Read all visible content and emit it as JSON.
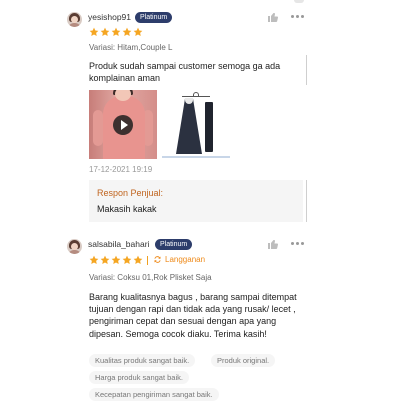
{
  "reviews": [
    {
      "username": "yesishop91",
      "badge": "Platinum",
      "rating": 5,
      "variation": "Variasi: Hitam,Couple L",
      "comment": "Produk sudah sampai customer semoga ga ada komplainan aman",
      "media": [
        {
          "type": "video",
          "icon": "play-icon"
        },
        {
          "type": "photo"
        }
      ],
      "timestamp": "17-12-2021 19:19",
      "seller_response": {
        "label": "Respon Penjual:",
        "text": "Makasih kakak"
      }
    },
    {
      "username": "salsabila_bahari",
      "badge": "Platinum",
      "rating": 5,
      "subscriber_label": "Langganan",
      "variation": "Variasi: Coksu 01,Rok Plisket Saja",
      "comment": "Barang kualitasnya bagus , barang sampai ditempat tujuan dengan rapi dan tidak ada yang rusak/ lecet , pengiriman cepat dan sesuai dengan apa yang dipesan. Semoga cocok diaku. Terima kasih!",
      "tags": [
        "Kualitas produk sangat baik.",
        "Produk original.",
        "Harga produk sangat baik.",
        "Kecepatan pengiriman sangat baik."
      ]
    }
  ],
  "colors": {
    "star": "#f5a623",
    "badge_bg": "#2d3d6b",
    "seller_label": "#c0641e",
    "langganan": "#ee8a1a"
  },
  "icons": {
    "like": "thumbs-up-icon",
    "more": "more-icon",
    "star": "star-icon",
    "langganan": "repeat-icon"
  }
}
